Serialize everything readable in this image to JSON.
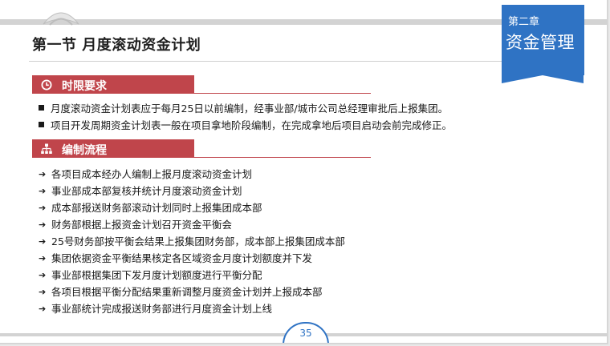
{
  "header": {
    "section_title": "第一节  月度滚动资金计划",
    "chapter_label": "第二章",
    "chapter_title": "资金管理"
  },
  "time_section": {
    "title": "时限要求",
    "icon": "clock-icon",
    "bullets": [
      "月度滚动资金计划表应于每月25日以前编制，经事业部/城市公司总经理审批后上报集团。",
      "项目开发周期资金计划表一般在项目拿地阶段编制，在完成拿地后项目启动会前完成修正。"
    ]
  },
  "process_section": {
    "title": "编制流程",
    "icon": "org-chart-icon",
    "steps": [
      "各项目成本经办人编制上报月度滚动资金计划",
      "事业部成本部复核并统计月度滚动资金计划",
      "成本部报送财务部滚动计划同时上报集团成本部",
      "财务部根据上报资金计划召开资金平衡会",
      "25号财务部按平衡会结果上报集团财务部，成本部上报集团成本部",
      "集团依据资金平衡结果核定各区域资金月度计划额度并下发",
      "事业部根据集团下发月度计划额度进行平衡分配",
      "各项目根据平衡分配结果重新调整月度资金计划并上报成本部",
      "事业部统计完成报送财务部进行月度资金计划上线"
    ]
  },
  "footer": {
    "page_number": "35"
  },
  "colors": {
    "accent_blue": "#2f73c4",
    "accent_red": "#c0454b"
  }
}
